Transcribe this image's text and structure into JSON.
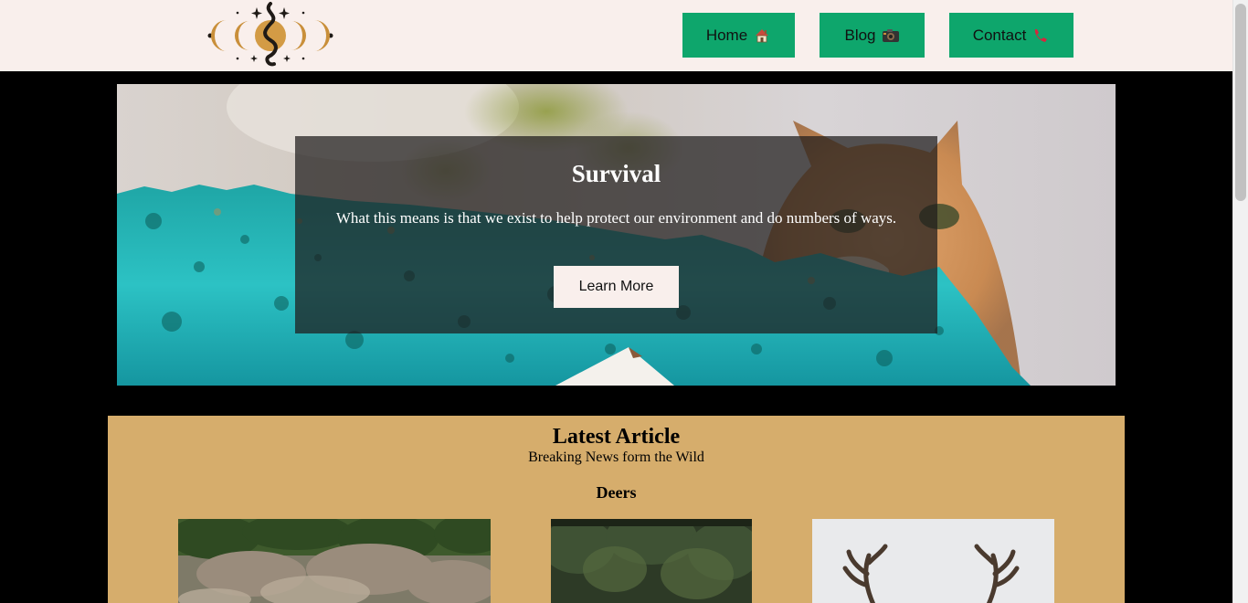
{
  "header": {
    "logo_icon": "moon-snake-logo-icon",
    "nav": [
      {
        "label": "Home",
        "icon": "house-icon"
      },
      {
        "label": "Blog",
        "icon": "camera-icon"
      },
      {
        "label": "Contact",
        "icon": "phone-icon"
      }
    ],
    "nav_color": "#0ea66c",
    "background": "#f9efec"
  },
  "hero": {
    "title": "Survival",
    "text": "What this means is that we exist to help protect our environment and do numbers of ways.",
    "button_label": "Learn More",
    "image": "cat-on-teal-wall-photo"
  },
  "article": {
    "title": "Latest Article",
    "subtitle": "Breaking News form the Wild",
    "section": "Deers",
    "background": "#d6ad6c",
    "images": [
      "field-shrubs-photo",
      "forest-trees-photo",
      "deer-antlers-photo"
    ]
  },
  "page": {
    "background": "#000000"
  }
}
